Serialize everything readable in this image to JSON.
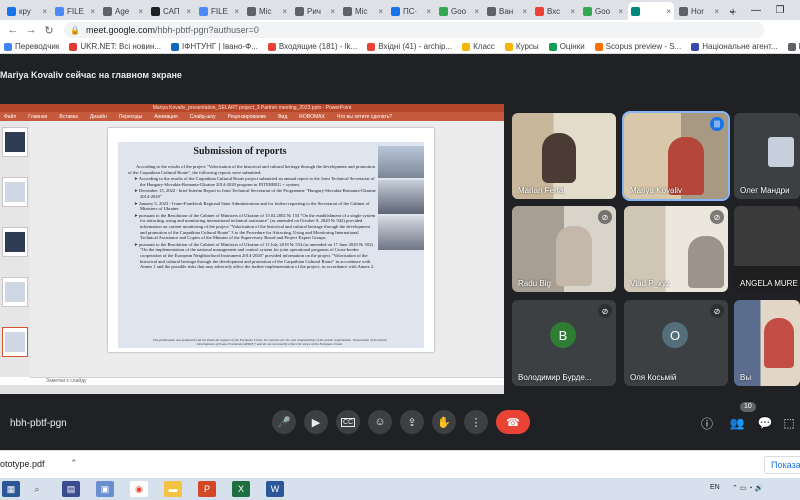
{
  "browser": {
    "tabs": [
      {
        "label": "кру",
        "color": "#1a73e8",
        "active": false
      },
      {
        "label": "FILE",
        "color": "#4c8bf5",
        "active": false
      },
      {
        "label": "Age",
        "color": "#5f6368",
        "active": false
      },
      {
        "label": "САП",
        "color": "#202124",
        "active": false
      },
      {
        "label": "FILE",
        "color": "#4c8bf5",
        "active": false
      },
      {
        "label": "Mic",
        "color": "#5f6368",
        "active": false
      },
      {
        "label": "Рич",
        "color": "#5f6368",
        "active": false
      },
      {
        "label": "Mic",
        "color": "#5f6368",
        "active": false
      },
      {
        "label": "ПС·",
        "color": "#1a73e8",
        "active": false
      },
      {
        "label": "Goo",
        "color": "#34a853",
        "active": false
      },
      {
        "label": "Ван",
        "color": "#5f6368",
        "active": false
      },
      {
        "label": "Вхс",
        "color": "#ea4335",
        "active": false
      },
      {
        "label": "Goo",
        "color": "#34a853",
        "active": false
      },
      {
        "label": "",
        "color": "#00897b",
        "active": true
      },
      {
        "label": "Hor",
        "color": "#5f6368",
        "active": false
      }
    ],
    "url_host": "meet.google.com",
    "url_path": "/hbh-pbtf-pgn?authuser=0",
    "bookmarks": [
      {
        "label": "Переводчик",
        "color": "#4285f4"
      },
      {
        "label": "UKR.NET: Всі новин...",
        "color": "#e53935"
      },
      {
        "label": "ІФНТУНГ | Івано-Ф...",
        "color": "#1565c0"
      },
      {
        "label": "Входящие (181) - lk...",
        "color": "#ea4335"
      },
      {
        "label": "Вхідні (41) - archip...",
        "color": "#ea4335"
      },
      {
        "label": "Класс",
        "color": "#f4b400"
      },
      {
        "label": "Курсы",
        "color": "#f4b400"
      },
      {
        "label": "Оцінки",
        "color": "#0f9d58"
      },
      {
        "label": "Scopus preview - S...",
        "color": "#ff6f00"
      },
      {
        "label": "Національне агент...",
        "color": "#3949ab"
      },
      {
        "label": "Lkonsevich@nung.e...",
        "color": "#5f6368"
      }
    ]
  },
  "meet": {
    "presenter_label": "Mariya Kovaliv сейчас на главном экране",
    "meeting_code": "hbh-pbtf-pgn",
    "participant_count": "10",
    "participants": [
      {
        "name": "Marian Fertal",
        "muted": false,
        "speaking": false
      },
      {
        "name": "Mariya Kovaliv",
        "muted": false,
        "speaking": true
      },
      {
        "name": "Олег Мандри",
        "muted": false,
        "speaking": false
      },
      {
        "name": "Radu Big",
        "muted": true,
        "speaking": false
      },
      {
        "name": "Vlad P_xyz",
        "muted": true,
        "speaking": false
      },
      {
        "name": "ANGELA MURE",
        "muted": true,
        "speaking": false
      },
      {
        "name": "Володимир Бурде...",
        "initial": "В",
        "color": "#2e7d32",
        "muted": true
      },
      {
        "name": "Оля Косьмій",
        "initial": "О",
        "color": "#546e7a",
        "muted": true
      },
      {
        "name": "Вы",
        "muted": false
      }
    ]
  },
  "powerpoint": {
    "title_bar": "Mariya Kovaliv_presentation_SELART project_3 Partner meeting_2023.pptx - PowerPoint",
    "ribbon_tabs": [
      "Файл",
      "Главная",
      "Вставка",
      "Дизайн",
      "Переходы",
      "Анимация",
      "Слайд-шоу",
      "Рецензирование",
      "Вид",
      "ROBOMAX",
      "Что вы хотите сделать?"
    ],
    "notes_placeholder": "Заметки к слайду"
  },
  "slide": {
    "title": "Submission of reports",
    "intro": "According to the results of the project \"Valorisation of the historical and cultural heritage through the development and promotion of the Carpathian Cultural Route\", the following reports were submitted:",
    "bullets": [
      "According to the results of the Carpathian Cultural Route project submitted an annual report to the Joint Technical Secretariat of the Hungary-Slovakia-Romania-Ukraine 2014-2020 program in INTERREG + system.",
      "December 15, 2022 - brief Interim Report to Joint Technical Secretariat of the Programme \"Hungary-Slovakia-Romania-Ukraine 2014-2020\"",
      "January 5, 2023 - Ivano-Frankivsk Regional State Administration and for further reporting to the Secretariat of the Cabinet of Ministers of Ukraine:",
      "pursuant to the Resolution of the Cabinet of Ministers of Ukraine of 15.02.2002 № 153 \"On the establishment of a single system for attracting, using and monitoring international technical assistance\" (as amended on October 9, 2020 № 942) provided information on current monitoring of the project \"Valorisation of the historical and cultural heritage through the development and promotion of the Carpathian Cultural Route\" 3 to the Procedure for Attracting, Using and Monitoring International Technical Assistance and Copies of the Minutes of the Supervisory Board and Project Expert Groups.",
      "pursuant to the Resolution of the Cabinet of Ministers of Ukraine of 11 July 2018 № 554 (as amended on 17 June 2020 № 502) \"On the implementation of the national management and control system for joint operational programs of Cross-border cooperation of the European Neighborhood Instrument 2014-2020\" provided information on the project \"Valorisation of the historical and cultural heritage through the development and promotion of the Carpathian Cultural Route\" in accordance with Annex 1 and the possible risks that may adversely affect the further implementation of the project, in accordance with Annex 2."
    ],
    "footer": "This publication was produced with the financial support of the European Union. Its contents are the sole responsibility of the public organization \"Association of Economic Development of Ivano-Frankivsk (AEDIF)\" and do not necessarily reflect the views of the European Union."
  },
  "downloads": {
    "file": "ototype.pdf",
    "show_all": "Показа"
  },
  "taskbar": {
    "lang": "EN"
  }
}
